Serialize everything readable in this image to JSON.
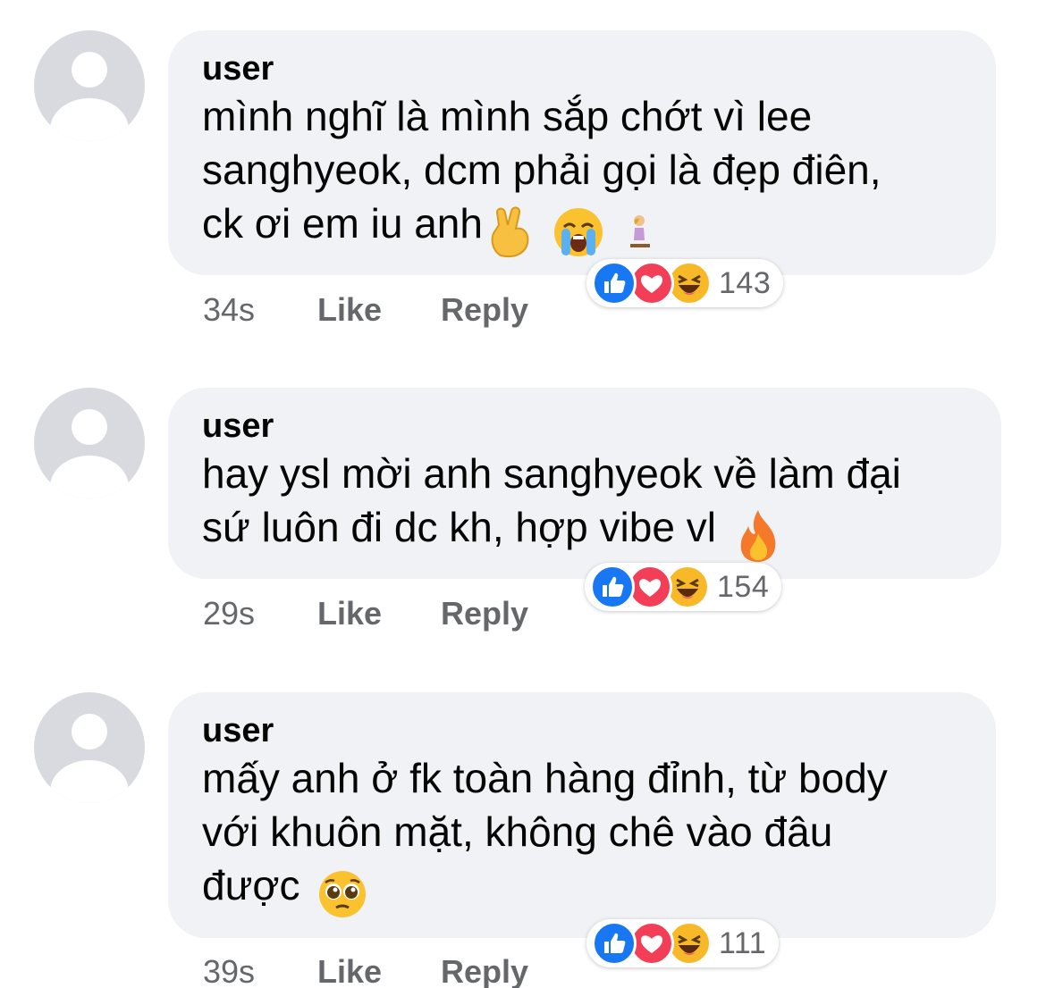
{
  "comments": [
    {
      "username": "user",
      "text": "mình nghĩ là mình sắp chớt vì lee\nsanghyeok, dcm phải gọi là đẹp điên,\nck ơi em iu anh",
      "emojis": [
        "crossed-fingers-icon",
        "loudly-crying-icon",
        "person-kneeling-icon"
      ],
      "time": "34s",
      "like_label": "Like",
      "reply_label": "Reply",
      "reaction_count": "143",
      "reactions": [
        "like",
        "love",
        "haha"
      ]
    },
    {
      "username": "user",
      "text": "hay ysl mời anh sanghyeok về làm đại\nsứ luôn đi dc kh, hợp vibe vl",
      "emojis": [
        "fire-icon"
      ],
      "time": "29s",
      "like_label": "Like",
      "reply_label": "Reply",
      "reaction_count": "154",
      "reactions": [
        "like",
        "love",
        "haha"
      ]
    },
    {
      "username": "user",
      "text": "mấy anh ở fk toàn hàng đỉnh, từ body\nvới khuôn mặt, không chê vào đâu\nđược",
      "emojis": [
        "pleading-face-icon"
      ],
      "time": "39s",
      "like_label": "Like",
      "reply_label": "Reply",
      "reaction_count": "111",
      "reactions": [
        "like",
        "love",
        "haha"
      ]
    }
  ],
  "colors": {
    "bubble_bg": "#f0f2f5",
    "avatar_bg": "#d8dadf",
    "meta_text": "#65676b",
    "like_blue": "#1877f2",
    "love_red": "#f33e58",
    "haha_yellow": "#f7b928"
  }
}
